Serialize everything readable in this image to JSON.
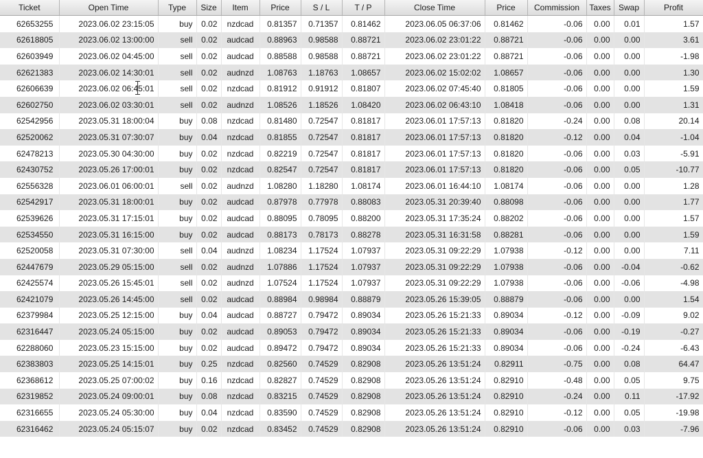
{
  "columns": [
    "Ticket",
    "Open Time",
    "Type",
    "Size",
    "Item",
    "Price",
    "S / L",
    "T / P",
    "Close Time",
    "Price",
    "Commission",
    "Taxes",
    "Swap",
    "Profit"
  ],
  "rows": [
    [
      "62653255",
      "2023.06.02 23:15:05",
      "buy",
      "0.02",
      "nzdcad",
      "0.81357",
      "0.71357",
      "0.81462",
      "2023.06.05 06:37:06",
      "0.81462",
      "-0.06",
      "0.00",
      "0.01",
      "1.57"
    ],
    [
      "62618805",
      "2023.06.02 13:00:00",
      "sell",
      "0.02",
      "audcad",
      "0.88963",
      "0.98588",
      "0.88721",
      "2023.06.02 23:01:22",
      "0.88721",
      "-0.06",
      "0.00",
      "0.00",
      "3.61"
    ],
    [
      "62603949",
      "2023.06.02 04:45:00",
      "sell",
      "0.02",
      "audcad",
      "0.88588",
      "0.98588",
      "0.88721",
      "2023.06.02 23:01:22",
      "0.88721",
      "-0.06",
      "0.00",
      "0.00",
      "-1.98"
    ],
    [
      "62621383",
      "2023.06.02 14:30:01",
      "sell",
      "0.02",
      "audnzd",
      "1.08763",
      "1.18763",
      "1.08657",
      "2023.06.02 15:02:02",
      "1.08657",
      "-0.06",
      "0.00",
      "0.00",
      "1.30"
    ],
    [
      "62606639",
      "2023.06.02 06:45:01",
      "sell",
      "0.02",
      "nzdcad",
      "0.81912",
      "0.91912",
      "0.81807",
      "2023.06.02 07:45:40",
      "0.81805",
      "-0.06",
      "0.00",
      "0.00",
      "1.59"
    ],
    [
      "62602750",
      "2023.06.02 03:30:01",
      "sell",
      "0.02",
      "audnzd",
      "1.08526",
      "1.18526",
      "1.08420",
      "2023.06.02 06:43:10",
      "1.08418",
      "-0.06",
      "0.00",
      "0.00",
      "1.31"
    ],
    [
      "62542956",
      "2023.05.31 18:00:04",
      "buy",
      "0.08",
      "nzdcad",
      "0.81480",
      "0.72547",
      "0.81817",
      "2023.06.01 17:57:13",
      "0.81820",
      "-0.24",
      "0.00",
      "0.08",
      "20.14"
    ],
    [
      "62520062",
      "2023.05.31 07:30:07",
      "buy",
      "0.04",
      "nzdcad",
      "0.81855",
      "0.72547",
      "0.81817",
      "2023.06.01 17:57:13",
      "0.81820",
      "-0.12",
      "0.00",
      "0.04",
      "-1.04"
    ],
    [
      "62478213",
      "2023.05.30 04:30:00",
      "buy",
      "0.02",
      "nzdcad",
      "0.82219",
      "0.72547",
      "0.81817",
      "2023.06.01 17:57:13",
      "0.81820",
      "-0.06",
      "0.00",
      "0.03",
      "-5.91"
    ],
    [
      "62430752",
      "2023.05.26 17:00:01",
      "buy",
      "0.02",
      "nzdcad",
      "0.82547",
      "0.72547",
      "0.81817",
      "2023.06.01 17:57:13",
      "0.81820",
      "-0.06",
      "0.00",
      "0.05",
      "-10.77"
    ],
    [
      "62556328",
      "2023.06.01 06:00:01",
      "sell",
      "0.02",
      "audnzd",
      "1.08280",
      "1.18280",
      "1.08174",
      "2023.06.01 16:44:10",
      "1.08174",
      "-0.06",
      "0.00",
      "0.00",
      "1.28"
    ],
    [
      "62542917",
      "2023.05.31 18:00:01",
      "buy",
      "0.02",
      "audcad",
      "0.87978",
      "0.77978",
      "0.88083",
      "2023.05.31 20:39:40",
      "0.88098",
      "-0.06",
      "0.00",
      "0.00",
      "1.77"
    ],
    [
      "62539626",
      "2023.05.31 17:15:01",
      "buy",
      "0.02",
      "audcad",
      "0.88095",
      "0.78095",
      "0.88200",
      "2023.05.31 17:35:24",
      "0.88202",
      "-0.06",
      "0.00",
      "0.00",
      "1.57"
    ],
    [
      "62534550",
      "2023.05.31 16:15:00",
      "buy",
      "0.02",
      "audcad",
      "0.88173",
      "0.78173",
      "0.88278",
      "2023.05.31 16:31:58",
      "0.88281",
      "-0.06",
      "0.00",
      "0.00",
      "1.59"
    ],
    [
      "62520058",
      "2023.05.31 07:30:00",
      "sell",
      "0.04",
      "audnzd",
      "1.08234",
      "1.17524",
      "1.07937",
      "2023.05.31 09:22:29",
      "1.07938",
      "-0.12",
      "0.00",
      "0.00",
      "7.11"
    ],
    [
      "62447679",
      "2023.05.29 05:15:00",
      "sell",
      "0.02",
      "audnzd",
      "1.07886",
      "1.17524",
      "1.07937",
      "2023.05.31 09:22:29",
      "1.07938",
      "-0.06",
      "0.00",
      "-0.04",
      "-0.62"
    ],
    [
      "62425574",
      "2023.05.26 15:45:01",
      "sell",
      "0.02",
      "audnzd",
      "1.07524",
      "1.17524",
      "1.07937",
      "2023.05.31 09:22:29",
      "1.07938",
      "-0.06",
      "0.00",
      "-0.06",
      "-4.98"
    ],
    [
      "62421079",
      "2023.05.26 14:45:00",
      "sell",
      "0.02",
      "audcad",
      "0.88984",
      "0.98984",
      "0.88879",
      "2023.05.26 15:39:05",
      "0.88879",
      "-0.06",
      "0.00",
      "0.00",
      "1.54"
    ],
    [
      "62379984",
      "2023.05.25 12:15:00",
      "buy",
      "0.04",
      "audcad",
      "0.88727",
      "0.79472",
      "0.89034",
      "2023.05.26 15:21:33",
      "0.89034",
      "-0.12",
      "0.00",
      "-0.09",
      "9.02"
    ],
    [
      "62316447",
      "2023.05.24 05:15:00",
      "buy",
      "0.02",
      "audcad",
      "0.89053",
      "0.79472",
      "0.89034",
      "2023.05.26 15:21:33",
      "0.89034",
      "-0.06",
      "0.00",
      "-0.19",
      "-0.27"
    ],
    [
      "62288060",
      "2023.05.23 15:15:00",
      "buy",
      "0.02",
      "audcad",
      "0.89472",
      "0.79472",
      "0.89034",
      "2023.05.26 15:21:33",
      "0.89034",
      "-0.06",
      "0.00",
      "-0.24",
      "-6.43"
    ],
    [
      "62383803",
      "2023.05.25 14:15:01",
      "buy",
      "0.25",
      "nzdcad",
      "0.82560",
      "0.74529",
      "0.82908",
      "2023.05.26 13:51:24",
      "0.82911",
      "-0.75",
      "0.00",
      "0.08",
      "64.47"
    ],
    [
      "62368612",
      "2023.05.25 07:00:02",
      "buy",
      "0.16",
      "nzdcad",
      "0.82827",
      "0.74529",
      "0.82908",
      "2023.05.26 13:51:24",
      "0.82910",
      "-0.48",
      "0.00",
      "0.05",
      "9.75"
    ],
    [
      "62319852",
      "2023.05.24 09:00:01",
      "buy",
      "0.08",
      "nzdcad",
      "0.83215",
      "0.74529",
      "0.82908",
      "2023.05.26 13:51:24",
      "0.82910",
      "-0.24",
      "0.00",
      "0.11",
      "-17.92"
    ],
    [
      "62316655",
      "2023.05.24 05:30:00",
      "buy",
      "0.04",
      "nzdcad",
      "0.83590",
      "0.74529",
      "0.82908",
      "2023.05.26 13:51:24",
      "0.82910",
      "-0.12",
      "0.00",
      "0.05",
      "-19.98"
    ],
    [
      "62316462",
      "2023.05.24 05:15:07",
      "buy",
      "0.02",
      "nzdcad",
      "0.83452",
      "0.74529",
      "0.82908",
      "2023.05.26 13:51:24",
      "0.82910",
      "-0.06",
      "0.00",
      "0.03",
      "-7.96"
    ]
  ]
}
